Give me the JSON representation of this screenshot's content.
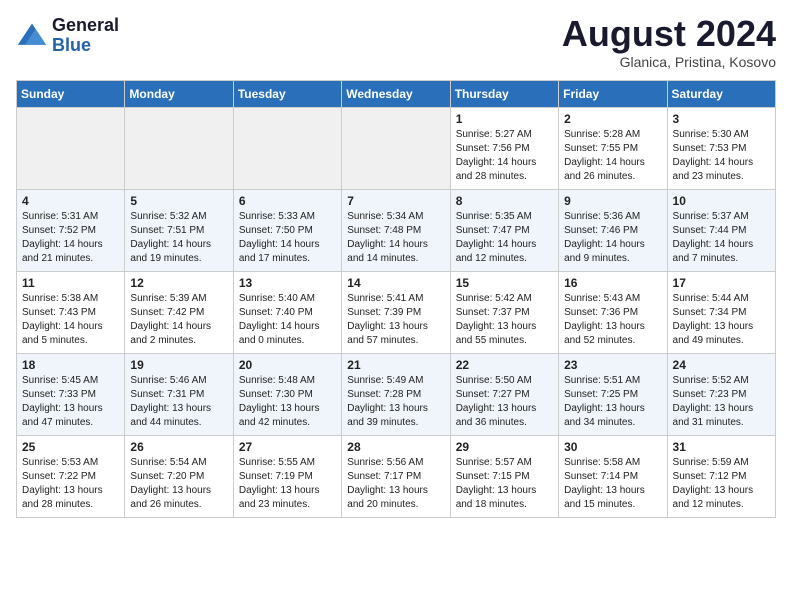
{
  "header": {
    "logo_line1": "General",
    "logo_line2": "Blue",
    "month_year": "August 2024",
    "location": "Glanica, Pristina, Kosovo"
  },
  "days_of_week": [
    "Sunday",
    "Monday",
    "Tuesday",
    "Wednesday",
    "Thursday",
    "Friday",
    "Saturday"
  ],
  "weeks": [
    [
      {
        "day": "",
        "detail": ""
      },
      {
        "day": "",
        "detail": ""
      },
      {
        "day": "",
        "detail": ""
      },
      {
        "day": "",
        "detail": ""
      },
      {
        "day": "1",
        "detail": "Sunrise: 5:27 AM\nSunset: 7:56 PM\nDaylight: 14 hours\nand 28 minutes."
      },
      {
        "day": "2",
        "detail": "Sunrise: 5:28 AM\nSunset: 7:55 PM\nDaylight: 14 hours\nand 26 minutes."
      },
      {
        "day": "3",
        "detail": "Sunrise: 5:30 AM\nSunset: 7:53 PM\nDaylight: 14 hours\nand 23 minutes."
      }
    ],
    [
      {
        "day": "4",
        "detail": "Sunrise: 5:31 AM\nSunset: 7:52 PM\nDaylight: 14 hours\nand 21 minutes."
      },
      {
        "day": "5",
        "detail": "Sunrise: 5:32 AM\nSunset: 7:51 PM\nDaylight: 14 hours\nand 19 minutes."
      },
      {
        "day": "6",
        "detail": "Sunrise: 5:33 AM\nSunset: 7:50 PM\nDaylight: 14 hours\nand 17 minutes."
      },
      {
        "day": "7",
        "detail": "Sunrise: 5:34 AM\nSunset: 7:48 PM\nDaylight: 14 hours\nand 14 minutes."
      },
      {
        "day": "8",
        "detail": "Sunrise: 5:35 AM\nSunset: 7:47 PM\nDaylight: 14 hours\nand 12 minutes."
      },
      {
        "day": "9",
        "detail": "Sunrise: 5:36 AM\nSunset: 7:46 PM\nDaylight: 14 hours\nand 9 minutes."
      },
      {
        "day": "10",
        "detail": "Sunrise: 5:37 AM\nSunset: 7:44 PM\nDaylight: 14 hours\nand 7 minutes."
      }
    ],
    [
      {
        "day": "11",
        "detail": "Sunrise: 5:38 AM\nSunset: 7:43 PM\nDaylight: 14 hours\nand 5 minutes."
      },
      {
        "day": "12",
        "detail": "Sunrise: 5:39 AM\nSunset: 7:42 PM\nDaylight: 14 hours\nand 2 minutes."
      },
      {
        "day": "13",
        "detail": "Sunrise: 5:40 AM\nSunset: 7:40 PM\nDaylight: 14 hours\nand 0 minutes."
      },
      {
        "day": "14",
        "detail": "Sunrise: 5:41 AM\nSunset: 7:39 PM\nDaylight: 13 hours\nand 57 minutes."
      },
      {
        "day": "15",
        "detail": "Sunrise: 5:42 AM\nSunset: 7:37 PM\nDaylight: 13 hours\nand 55 minutes."
      },
      {
        "day": "16",
        "detail": "Sunrise: 5:43 AM\nSunset: 7:36 PM\nDaylight: 13 hours\nand 52 minutes."
      },
      {
        "day": "17",
        "detail": "Sunrise: 5:44 AM\nSunset: 7:34 PM\nDaylight: 13 hours\nand 49 minutes."
      }
    ],
    [
      {
        "day": "18",
        "detail": "Sunrise: 5:45 AM\nSunset: 7:33 PM\nDaylight: 13 hours\nand 47 minutes."
      },
      {
        "day": "19",
        "detail": "Sunrise: 5:46 AM\nSunset: 7:31 PM\nDaylight: 13 hours\nand 44 minutes."
      },
      {
        "day": "20",
        "detail": "Sunrise: 5:48 AM\nSunset: 7:30 PM\nDaylight: 13 hours\nand 42 minutes."
      },
      {
        "day": "21",
        "detail": "Sunrise: 5:49 AM\nSunset: 7:28 PM\nDaylight: 13 hours\nand 39 minutes."
      },
      {
        "day": "22",
        "detail": "Sunrise: 5:50 AM\nSunset: 7:27 PM\nDaylight: 13 hours\nand 36 minutes."
      },
      {
        "day": "23",
        "detail": "Sunrise: 5:51 AM\nSunset: 7:25 PM\nDaylight: 13 hours\nand 34 minutes."
      },
      {
        "day": "24",
        "detail": "Sunrise: 5:52 AM\nSunset: 7:23 PM\nDaylight: 13 hours\nand 31 minutes."
      }
    ],
    [
      {
        "day": "25",
        "detail": "Sunrise: 5:53 AM\nSunset: 7:22 PM\nDaylight: 13 hours\nand 28 minutes."
      },
      {
        "day": "26",
        "detail": "Sunrise: 5:54 AM\nSunset: 7:20 PM\nDaylight: 13 hours\nand 26 minutes."
      },
      {
        "day": "27",
        "detail": "Sunrise: 5:55 AM\nSunset: 7:19 PM\nDaylight: 13 hours\nand 23 minutes."
      },
      {
        "day": "28",
        "detail": "Sunrise: 5:56 AM\nSunset: 7:17 PM\nDaylight: 13 hours\nand 20 minutes."
      },
      {
        "day": "29",
        "detail": "Sunrise: 5:57 AM\nSunset: 7:15 PM\nDaylight: 13 hours\nand 18 minutes."
      },
      {
        "day": "30",
        "detail": "Sunrise: 5:58 AM\nSunset: 7:14 PM\nDaylight: 13 hours\nand 15 minutes."
      },
      {
        "day": "31",
        "detail": "Sunrise: 5:59 AM\nSunset: 7:12 PM\nDaylight: 13 hours\nand 12 minutes."
      }
    ]
  ]
}
